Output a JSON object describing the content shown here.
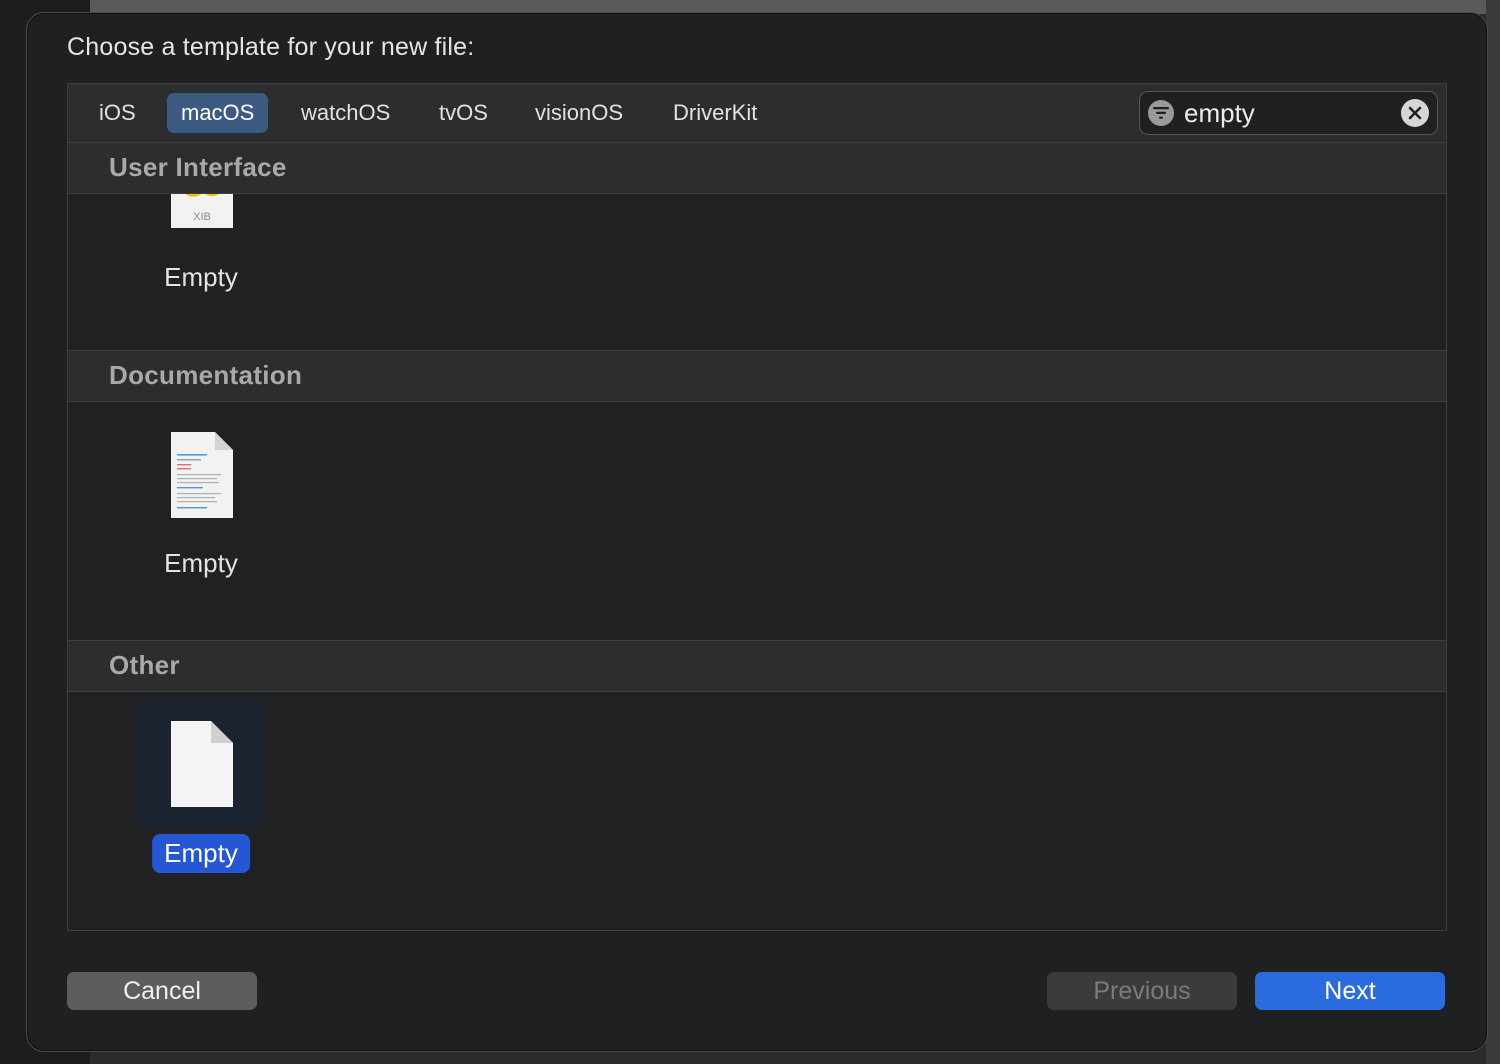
{
  "sheet": {
    "title": "Choose a template for your new file:"
  },
  "platform_tabs": [
    {
      "label": "iOS",
      "selected": false
    },
    {
      "label": "macOS",
      "selected": true
    },
    {
      "label": "watchOS",
      "selected": false
    },
    {
      "label": "tvOS",
      "selected": false
    },
    {
      "label": "visionOS",
      "selected": false
    },
    {
      "label": "DriverKit",
      "selected": false
    }
  ],
  "search": {
    "value": "empty",
    "filter_icon": "filter-icon",
    "clear_icon": "clear-icon"
  },
  "sections": [
    {
      "header": "User Interface",
      "templates": [
        {
          "label": "Empty",
          "icon": "xib-file-icon",
          "icon_text": "XIB",
          "selected": false
        }
      ]
    },
    {
      "header": "Documentation",
      "templates": [
        {
          "label": "Empty",
          "icon": "documentation-file-icon",
          "selected": false
        }
      ]
    },
    {
      "header": "Other",
      "templates": [
        {
          "label": "Empty",
          "icon": "blank-file-icon",
          "selected": true
        }
      ]
    }
  ],
  "buttons": {
    "cancel": "Cancel",
    "previous": "Previous",
    "next": "Next",
    "previous_enabled": false
  },
  "colors": {
    "selection_blue": "#2556d3",
    "tab_selected": "#3c5a82",
    "next_button": "#2a6bde"
  }
}
